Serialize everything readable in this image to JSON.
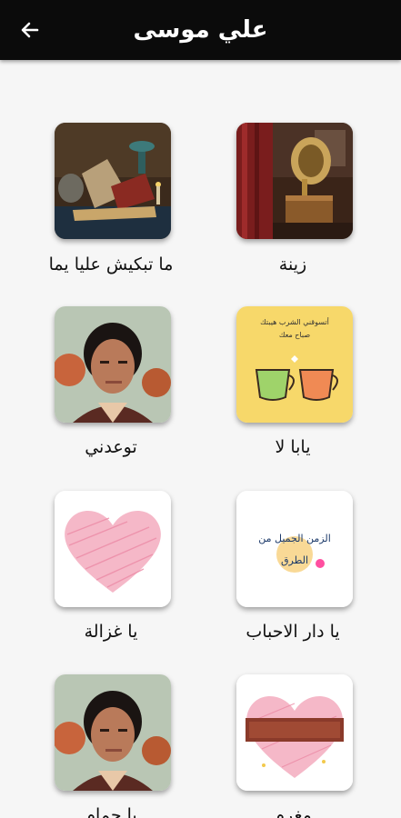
{
  "header": {
    "title": "علي موسى",
    "back_icon": "arrow-left-icon",
    "background": "#0b0b0b"
  },
  "songs": [
    {
      "label": "زينة",
      "image": "gramophone-image"
    },
    {
      "label": "ما تبكيش عليا يما",
      "image": "still-life-image"
    },
    {
      "label": "يابا لا",
      "image": "tea-cups-image"
    },
    {
      "label": "توعدني",
      "image": "singer-portrait-image"
    },
    {
      "label": "يا دار الاحباب",
      "image": "quote-card-image"
    },
    {
      "label": "يا غزالة",
      "image": "pink-heart-image"
    },
    {
      "label": "مغرم",
      "image": "heart-banner-image"
    },
    {
      "label": "يا حمام",
      "image": "singer-portrait-image"
    }
  ],
  "images": {
    "tea_cups_caption_1": "أتسوقني الشرب هيبتك",
    "tea_cups_caption_2": "صباح معك",
    "quote_card_text_1": "الزمن الجميل من",
    "quote_card_text_2": "الطرق"
  }
}
